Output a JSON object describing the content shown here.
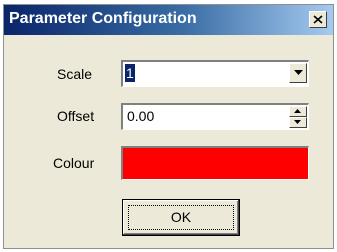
{
  "dialog": {
    "title": "Parameter Configuration",
    "close_icon": "close-icon"
  },
  "form": {
    "scale_label": "Scale",
    "scale_value": "1",
    "offset_label": "Offset",
    "offset_value": "0.00",
    "colour_label": "Colour",
    "colour_value": "#ff0000"
  },
  "buttons": {
    "ok_label": "OK"
  },
  "icons": {
    "dropdown": "chevron-down-icon",
    "spin_up": "spin-up-icon",
    "spin_down": "spin-down-icon"
  }
}
